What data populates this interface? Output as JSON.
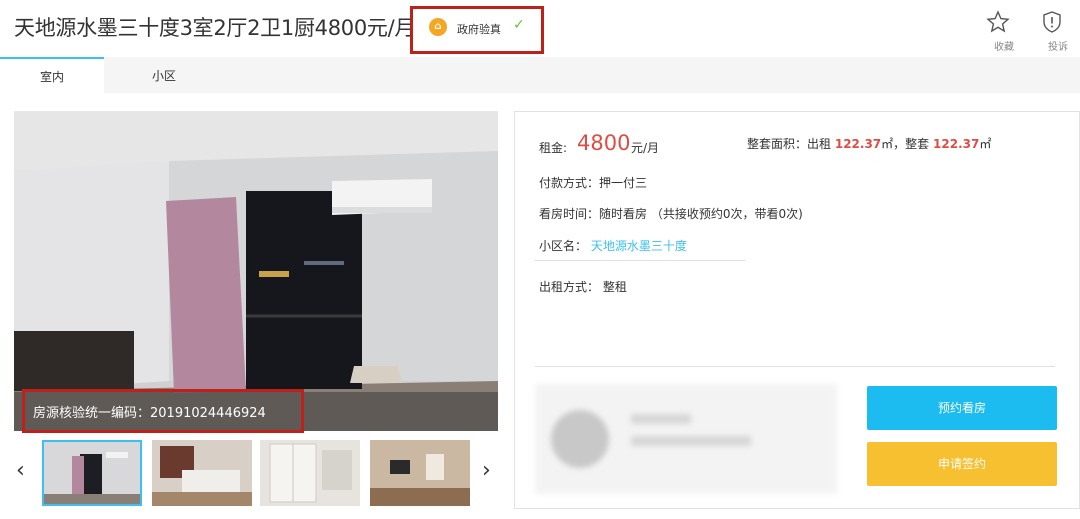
{
  "header": {
    "title": "天地源水墨三十度3室2厅2卫1厨4800元/月",
    "badge_icon": "government-icon",
    "badge_label": "政府验真",
    "badge_check": "✓",
    "favorite_label": "收藏",
    "report_label": "投诉"
  },
  "tabs": [
    {
      "label": "室内",
      "active": true
    },
    {
      "label": "小区",
      "active": false
    }
  ],
  "gallery": {
    "verification_code": "房源核验统一编码：20191024446924",
    "thumb_count": 4,
    "prev_icon": "‹",
    "next_icon": "›"
  },
  "details": {
    "rent_label": "租金:",
    "rent_value": "4800",
    "rent_unit": "元/月",
    "area_prefix": "整套面积：出租",
    "area_rent": "122.37",
    "area_unit": "㎡",
    "area_sep": "，整套",
    "area_total": "122.37",
    "payment": "付款方式：押一付三",
    "viewing": "看房时间：随时看房  （共接收预约0次，带看0次)",
    "community_label": "小区名：",
    "community_name": "天地源水墨三十度",
    "rent_type": "出租方式：  整租"
  },
  "actions": {
    "book_label": "预约看房",
    "sign_label": "申请签约"
  },
  "colors": {
    "accent": "#1cbcf0",
    "price": "#e04c43",
    "sign": "#f7c030",
    "highlight_box": "#c0201a"
  }
}
